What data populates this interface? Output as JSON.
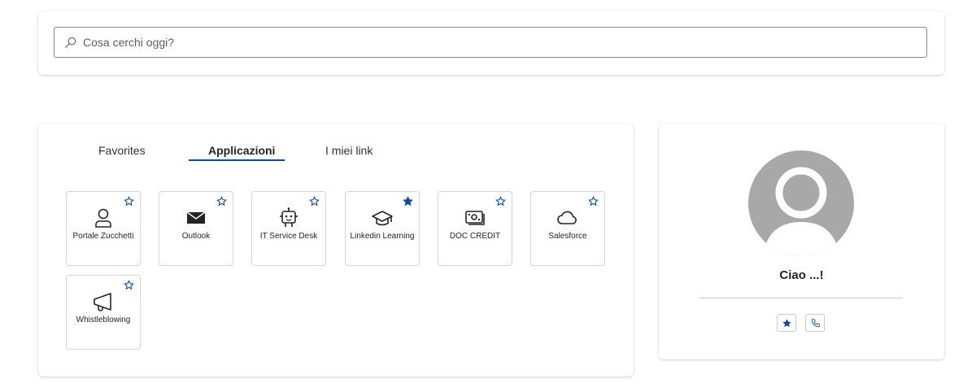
{
  "search": {
    "placeholder": "Cosa cerchi oggi?",
    "icon": "search-icon"
  },
  "tabs": [
    {
      "label": "Favorites",
      "active": false
    },
    {
      "label": "Applicazioni",
      "active": true
    },
    {
      "label": "I miei link",
      "active": false
    }
  ],
  "apps": [
    {
      "label": "Portale Zucchetti",
      "icon": "person-icon",
      "favorite": false
    },
    {
      "label": "Outlook",
      "icon": "mail-icon",
      "favorite": false
    },
    {
      "label": "IT Service Desk",
      "icon": "bot-icon",
      "favorite": false
    },
    {
      "label": "Linkedin Learning",
      "icon": "graduation-cap-icon",
      "favorite": true
    },
    {
      "label": "DOC CREDIT",
      "icon": "money-icon",
      "favorite": false
    },
    {
      "label": "Salesforce",
      "icon": "cloud-icon",
      "favorite": false
    },
    {
      "label": "Whistleblowing",
      "icon": "megaphone-icon",
      "favorite": false
    }
  ],
  "profile": {
    "greeting": "Ciao ...!",
    "avatar_icon": "avatar-placeholder-icon",
    "actions": [
      "star-icon",
      "phone-icon"
    ]
  },
  "colors": {
    "accent": "#0f4aa0",
    "border": "#d6d6d6",
    "avatar_bg": "#a8a8a8"
  }
}
